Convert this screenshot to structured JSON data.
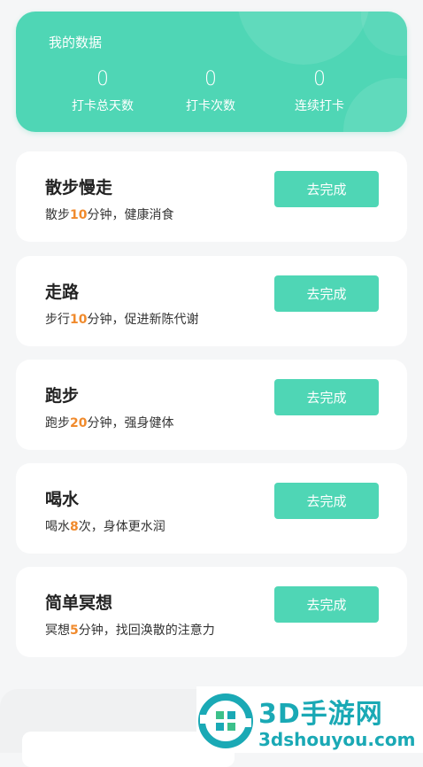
{
  "stats": {
    "title": "我的数据",
    "items": [
      {
        "value": "0",
        "label": "打卡总天数"
      },
      {
        "value": "0",
        "label": "打卡次数"
      },
      {
        "value": "0",
        "label": "连续打卡"
      }
    ]
  },
  "tasks": [
    {
      "name": "散步慢走",
      "desc_pre": "散步",
      "desc_num": "10",
      "desc_post": "分钟，健康消食",
      "button": "去完成"
    },
    {
      "name": "走路",
      "desc_pre": "步行",
      "desc_num": "10",
      "desc_post": "分钟，促进新陈代谢",
      "button": "去完成"
    },
    {
      "name": "跑步",
      "desc_pre": "跑步",
      "desc_num": "20",
      "desc_post": "分钟，强身健体",
      "button": "去完成"
    },
    {
      "name": "喝水",
      "desc_pre": "喝水",
      "desc_num": "8",
      "desc_post": "次，身体更水润",
      "button": "去完成"
    },
    {
      "name": "简单冥想",
      "desc_pre": "冥想",
      "desc_num": "5",
      "desc_post": "分钟，找回涣散的注意力",
      "button": "去完成"
    }
  ],
  "watermark": {
    "brand": "3D手游网",
    "url": "3dshouyou.com"
  },
  "colors": {
    "accent": "#4fd6b5",
    "highlight": "#f08a2c",
    "watermark": "#1aa9b5"
  }
}
